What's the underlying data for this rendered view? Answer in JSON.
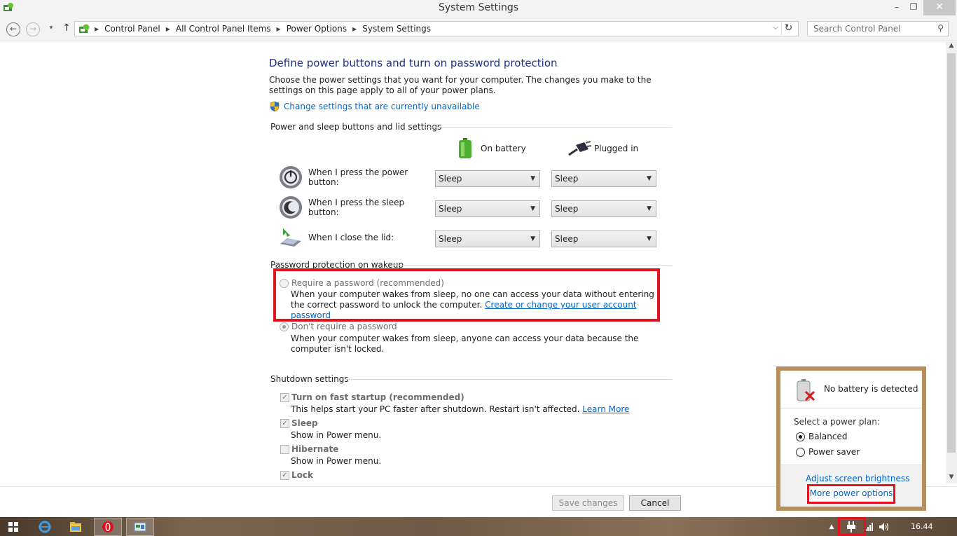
{
  "window": {
    "title": "System Settings",
    "minimize": "–",
    "maximize": "❐",
    "close": "✕"
  },
  "nav": {
    "back": "←",
    "forward": "→",
    "recent": "▾",
    "up": "↑",
    "breadcrumbs": [
      "Control Panel",
      "All Control Panel Items",
      "Power Options",
      "System Settings"
    ],
    "search_placeholder": "Search Control Panel"
  },
  "content": {
    "heading": "Define power buttons and turn on password protection",
    "description": "Choose the power settings that you want for your computer. The changes you make to the settings on this page apply to all of your power plans.",
    "change_link": "Change settings that are currently unavailable",
    "buttons_section": "Power and sleep buttons and lid settings",
    "col_battery": "On battery",
    "col_plugged": "Plugged in",
    "rows": [
      {
        "label": "When I press the power button:",
        "battery": "Sleep",
        "plugged": "Sleep"
      },
      {
        "label": "When I press the sleep button:",
        "battery": "Sleep",
        "plugged": "Sleep"
      },
      {
        "label": "When I close the lid:",
        "battery": "Sleep",
        "plugged": "Sleep"
      }
    ],
    "password_section": "Password protection on wakeup",
    "require_label": "Require a password (recommended)",
    "require_desc": "When your computer wakes from sleep, no one can access your data without entering the correct password to unlock the computer.",
    "require_link": "Create or change your user account password",
    "dont_require_label": "Don't require a password",
    "dont_require_desc": "When your computer wakes from sleep, anyone can access your data because the computer isn't locked.",
    "shutdown_section": "Shutdown settings",
    "fast_startup_label": "Turn on fast startup (recommended)",
    "fast_startup_desc": "This helps start your PC faster after shutdown. Restart isn't affected.",
    "learn_more": "Learn More",
    "sleep_label": "Sleep",
    "sleep_desc": "Show in Power menu.",
    "hibernate_label": "Hibernate",
    "hibernate_desc": "Show in Power menu.",
    "lock_label": "Lock"
  },
  "footer": {
    "save": "Save changes",
    "cancel": "Cancel"
  },
  "flyout": {
    "status": "No battery is detected",
    "plan_label": "Select a power plan:",
    "plans": [
      "Balanced",
      "Power saver"
    ],
    "brightness_link": "Adjust screen brightness",
    "more_link": "More power options"
  },
  "taskbar": {
    "clock": "16.44"
  },
  "colors": {
    "heading": "#1e3287",
    "link": "#0066cc",
    "highlight": "#e2131f"
  }
}
